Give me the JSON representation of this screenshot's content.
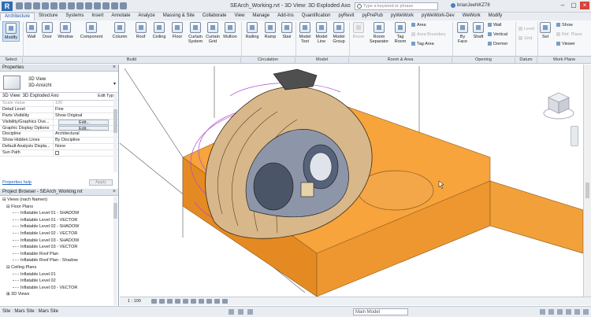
{
  "app": {
    "logo": "R",
    "title": "SEArch_Working.rvt - 3D View: 3D Exploded Axo"
  },
  "search": {
    "placeholder": "Type a keyword or phrase"
  },
  "user": {
    "name": "brianJeeNKZ78"
  },
  "tabs": [
    "Architecture",
    "Structure",
    "Systems",
    "Insert",
    "Annotate",
    "Analyze",
    "Massing & Site",
    "Collaborate",
    "View",
    "Manage",
    "Add-Ins",
    "Quantification",
    "pyRevit",
    "pyPrePub",
    "pyWeWork",
    "pyWeWork-Dev",
    "WeWork",
    "Modify"
  ],
  "ribbon": {
    "buttons": [
      "Modify",
      "Wall",
      "Door",
      "Window",
      "Component",
      "Column",
      "Roof",
      "Ceiling",
      "Floor",
      "Curtain System",
      "Curtain Grid",
      "Mullion",
      "Railing",
      "Ramp",
      "Stair",
      "Model Text",
      "Model Line",
      "Model Group",
      "Room",
      "Room Separator",
      "Tag Room",
      "By Face",
      "Shaft",
      "Set"
    ],
    "small": [
      "Area",
      "Area Boundary",
      "Tag Area",
      "Wall",
      "Vertical",
      "Dormer",
      "Level",
      "Grid",
      "Show",
      "Ref. Plane",
      "Viewer"
    ],
    "groups": [
      "Select",
      "Build",
      "Circulation",
      "Model",
      "Room & Area",
      "Opening",
      "Datum",
      "Work Plane"
    ]
  },
  "properties": {
    "title": "Properties",
    "type_line1": "3D View",
    "type_line2": "3D-Ansicht",
    "selector": "3D View: 3D Exploded Axo",
    "edit_type": "Edit Type",
    "rows": [
      {
        "k": "Scale Value",
        "v": "100"
      },
      {
        "k": "Detail Level",
        "v": "Fine"
      },
      {
        "k": "Parts Visibility",
        "v": "Show Original"
      },
      {
        "k": "Visibility/Graphics Ove...",
        "v": "Edit..."
      },
      {
        "k": "Graphic Display Options",
        "v": "Edit..."
      },
      {
        "k": "Discipline",
        "v": "Architectural"
      },
      {
        "k": "Show Hidden Lines",
        "v": "By Discipline"
      },
      {
        "k": "Default Analysis Displa...",
        "v": "None"
      },
      {
        "k": "Sun Path",
        "v": ""
      }
    ],
    "help": "Properties help",
    "apply": "Apply"
  },
  "browser": {
    "title": "Project Browser - SEArch_Working.rvt",
    "root": "Views (nach Namen)",
    "floor_plans": "Floor Plans",
    "floor_items": [
      "Inflatable Level 01 - SHADOW",
      "Inflatable Level 01 - VECTOR",
      "Inflatable Level 02 - SHADOW",
      "Inflatable Level 02 - VECTOR",
      "Inflatable Level 03 - SHADOW",
      "Inflatable Level 03 - VECTOR",
      "Inflatable Roof Plan",
      "Inflatable Roof Plan - Shadow"
    ],
    "ceiling_plans": "Ceiling Plans",
    "ceiling_items": [
      "Inflatable Level 01",
      "Inflatable Level 02",
      "Inflatable Level 03 - VECTOR"
    ],
    "views3d": "3D Views"
  },
  "viewbar": {
    "scale": "1 : 100"
  },
  "status": {
    "text": "Site : Mars Site : Mars Site",
    "workset": "Main Model"
  },
  "colors": {
    "block": "#f29a33",
    "accent": "#1b4f9c"
  }
}
